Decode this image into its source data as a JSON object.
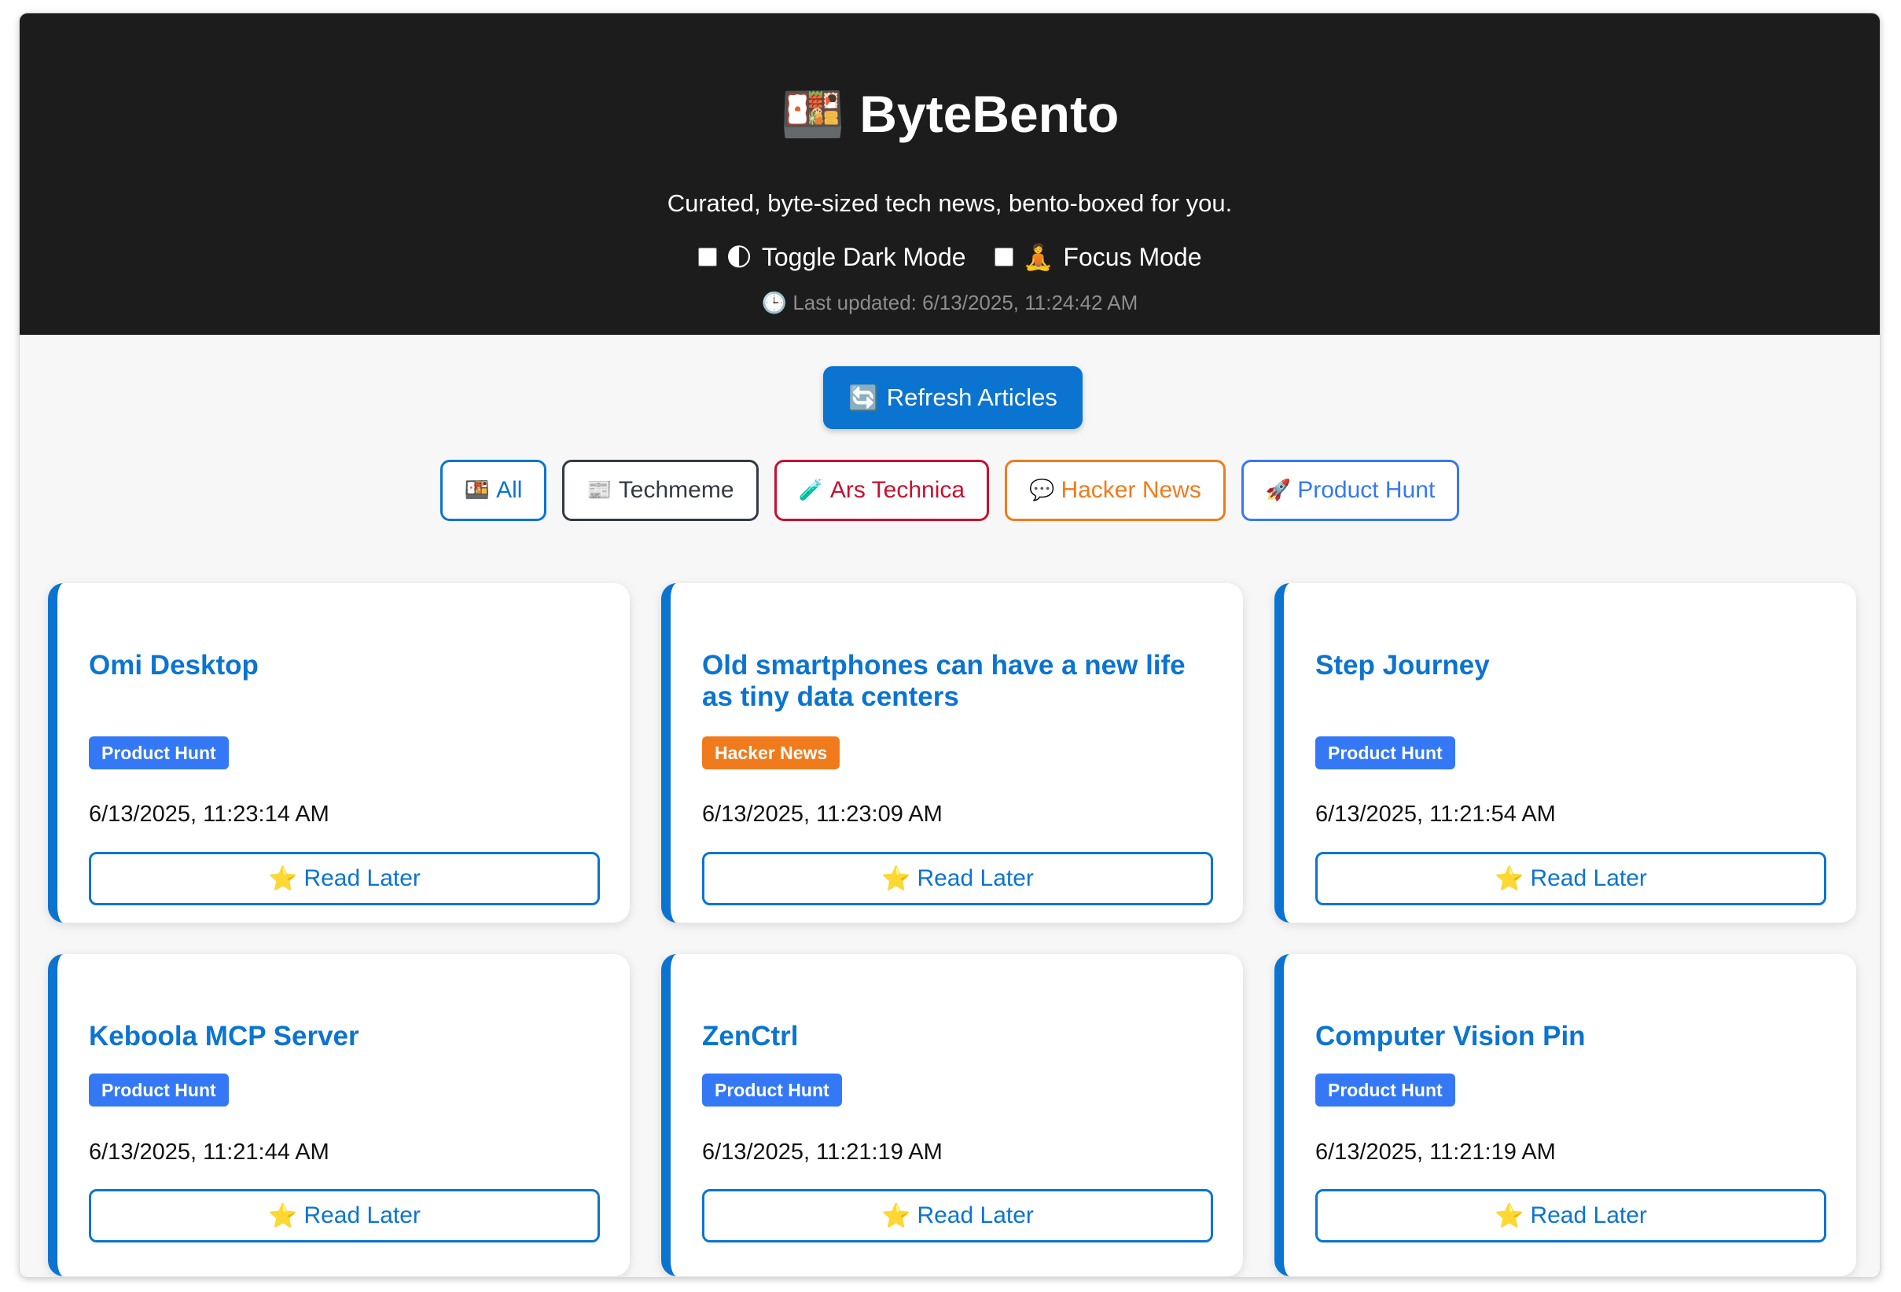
{
  "header": {
    "logo_emoji": "🍱",
    "title": "ByteBento",
    "tagline": "Curated, byte-sized tech news, bento-boxed for you.",
    "dark_mode": {
      "icon": "🌓",
      "label": "Toggle Dark Mode",
      "checked": false
    },
    "focus_mode": {
      "icon": "🧘",
      "label": "Focus Mode",
      "checked": false
    },
    "updated_icon": "🕒",
    "last_updated": "Last updated: 6/13/2025, 11:24:42 AM"
  },
  "toolbar": {
    "refresh_icon": "🔄",
    "refresh_label": "Refresh Articles"
  },
  "filters": [
    {
      "icon": "🍱",
      "label": "All",
      "color": "#0b74d1"
    },
    {
      "icon": "📰",
      "label": "Techmeme",
      "color": "#333a44"
    },
    {
      "icon": "🧪",
      "label": "Ars Technica",
      "color": "#c8102e"
    },
    {
      "icon": "💬",
      "label": "Hacker News",
      "color": "#f07b1d"
    },
    {
      "icon": "🚀",
      "label": "Product Hunt",
      "color": "#3478f6"
    }
  ],
  "source_colors": {
    "Product Hunt": "#3478f6",
    "Hacker News": "#f07b1d"
  },
  "read_later": {
    "icon": "⭐",
    "label": "Read Later"
  },
  "articles": [
    {
      "title": "Omi Desktop",
      "source": "Product Hunt",
      "date": "6/13/2025, 11:23:14 AM"
    },
    {
      "title": "Old smartphones can have a new life as tiny data centers",
      "source": "Hacker News",
      "date": "6/13/2025, 11:23:09 AM"
    },
    {
      "title": "Step Journey",
      "source": "Product Hunt",
      "date": "6/13/2025, 11:21:54 AM"
    },
    {
      "title": "Keboola MCP Server",
      "source": "Product Hunt",
      "date": "6/13/2025, 11:21:44 AM"
    },
    {
      "title": "ZenCtrl",
      "source": "Product Hunt",
      "date": "6/13/2025, 11:21:19 AM"
    },
    {
      "title": "Computer Vision Pin",
      "source": "Product Hunt",
      "date": "6/13/2025, 11:21:19 AM"
    }
  ]
}
